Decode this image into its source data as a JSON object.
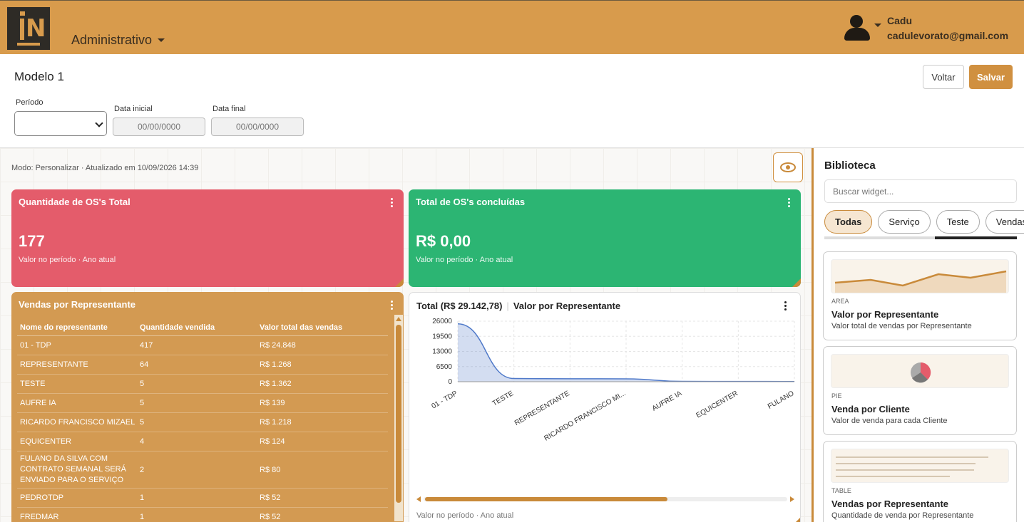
{
  "header": {
    "module": "Administrativo",
    "user_name": "Cadu",
    "user_email": "cadulevorato@gmail.com"
  },
  "page": {
    "title": "Modelo 1",
    "back_label": "Voltar",
    "save_label": "Salvar",
    "period_label": "Período",
    "start_label": "Data inicial",
    "start_placeholder": "00/00/0000",
    "end_label": "Data final",
    "end_placeholder": "00/00/0000"
  },
  "canvas": {
    "mode_text": "Modo: Personalizar · Atualizado em 10/09/2026 14:39"
  },
  "cards": {
    "total_os": {
      "title": "Quantidade de OS's Total",
      "value": "177",
      "subtitle": "Valor no período · Ano atual",
      "color": "#e45c6b"
    },
    "done_os": {
      "title": "Total de OS's concluídas",
      "value": "R$ 0,00",
      "subtitle": "Valor no período · Ano atual",
      "color": "#2cb573"
    },
    "sales_table": {
      "title": "Vendas por Representante",
      "color": "#d39a52",
      "columns": [
        "Nome do representante",
        "Quantidade vendida",
        "Valor total das vendas"
      ],
      "rows": [
        [
          "01 - TDP",
          "417",
          "R$ 24.848"
        ],
        [
          "REPRESENTANTE",
          "64",
          "R$ 1.268"
        ],
        [
          "TESTE",
          "5",
          "R$ 1.362"
        ],
        [
          "AUFRE IA",
          "5",
          "R$ 139"
        ],
        [
          "RICARDO FRANCISCO MIZAEL",
          "5",
          "R$ 1.218"
        ],
        [
          "EQUICENTER",
          "4",
          "R$ 124"
        ],
        [
          "FULANO DA SILVA COM CONTRATO SEMANAL SERÁ ENVIADO PARA O SERVIÇO",
          "2",
          "R$ 80"
        ],
        [
          "PEDROTDP",
          "1",
          "R$ 52"
        ],
        [
          "FREDMAR",
          "1",
          "R$ 52"
        ]
      ]
    },
    "chart": {
      "total_label": "Total (R$ 29.142,78)",
      "title": "Valor por Representante",
      "subtitle": "Valor no período · Ano atual"
    }
  },
  "chart_data": {
    "type": "area",
    "title": "Valor por Representante",
    "categories": [
      "01 - TDP",
      "TESTE",
      "REPRESENTANTE",
      "RICARDO FRANCISCO MI...",
      "AUFRE IA",
      "EQUICENTER",
      "FULANO"
    ],
    "values": [
      24848,
      1362,
      1268,
      1218,
      139,
      124,
      80
    ],
    "y_ticks": [
      "26000",
      "19500",
      "13000",
      "6500",
      "0"
    ],
    "ylim": [
      0,
      26000
    ],
    "color": "#4f79c9",
    "grid": true
  },
  "sidebar": {
    "title": "Biblioteca",
    "search_placeholder": "Buscar widget...",
    "chips": [
      "Todas",
      "Serviço",
      "Teste",
      "Vendas"
    ],
    "widgets": [
      {
        "type": "AREA",
        "title": "Valor por Representante",
        "desc": "Valor total de vendas por Representante"
      },
      {
        "type": "PIE",
        "title": "Venda por Cliente",
        "desc": "Valor de venda para cada Cliente"
      },
      {
        "type": "TABLE",
        "title": "Vendas por Representante",
        "desc": "Quantidade de venda por Representante"
      }
    ]
  }
}
